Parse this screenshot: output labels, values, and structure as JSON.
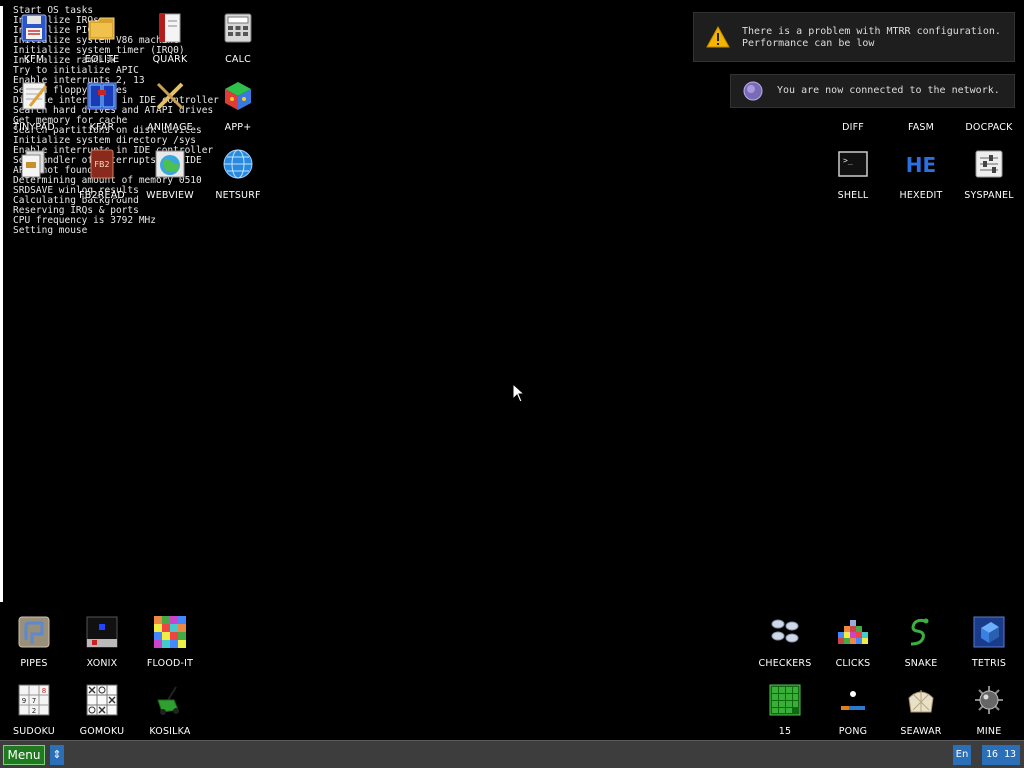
{
  "boot_log": [
    "Start OS tasks",
    "Initialize IRQs",
    "Initialize PIC",
    "Initialize system V86 machine",
    "Initialize system timer (IRQ0)",
    "Initialize ramdisk",
    "Try to initialize APIC",
    "Enable interrupts 2, 13",
    "Search floppy drives",
    "Disable interrupts in IDE controller",
    "Search hard drives and ATAPI drives",
    "Get memory for cache",
    "Search partitions on disk devices",
    "Initialize system directory /sys",
    "Enable interrupts in IDE controller",
    "Set handler of interrupts for IDE",
    "APIC not found",
    "Determining amount of memory 0510",
    "SRDSAVE winlog_results",
    "Calculating background",
    "Reserving IRQs & ports",
    "CPU frequency is 3792 MHz",
    "Setting mouse"
  ],
  "icons_left": [
    {
      "name": "kfm",
      "label": "KFM"
    },
    {
      "name": "eolite",
      "label": "EOLITE"
    },
    {
      "name": "quark",
      "label": "QUARK"
    },
    {
      "name": "calc",
      "label": "CALC"
    },
    {
      "name": "tinypad",
      "label": "TINYPAD"
    },
    {
      "name": "kfar",
      "label": "KFAR"
    },
    {
      "name": "animage",
      "label": "ANIMAGE"
    },
    {
      "name": "app-plus",
      "label": "APP+"
    },
    {
      "name": "fb2read",
      "label": "FB2READ"
    },
    {
      "name": "webview",
      "label": "WEBVIEW"
    },
    {
      "name": "netsurf",
      "label": "NETSURF"
    }
  ],
  "icons_right": [
    {
      "name": "diff",
      "label": "DIFF"
    },
    {
      "name": "fasm",
      "label": "FASM"
    },
    {
      "name": "docpack",
      "label": "DOCPACK"
    },
    {
      "name": "shell",
      "label": "SHELL"
    },
    {
      "name": "hexedit",
      "label": "HEXEDIT"
    },
    {
      "name": "syspanel",
      "label": "SYSPANEL"
    }
  ],
  "icons_games_left": [
    {
      "name": "pipes",
      "label": "PIPES"
    },
    {
      "name": "xonix",
      "label": "XONIX"
    },
    {
      "name": "flood-it",
      "label": "FLOOD-IT"
    },
    {
      "name": "sudoku",
      "label": "SUDOKU"
    },
    {
      "name": "gomoku",
      "label": "GOMOKU"
    },
    {
      "name": "kosilka",
      "label": "KOSILKA"
    }
  ],
  "icons_games_right": [
    {
      "name": "checkers",
      "label": "CHECKERS"
    },
    {
      "name": "clicks",
      "label": "CLICKS"
    },
    {
      "name": "snake",
      "label": "SNAKE"
    },
    {
      "name": "tetris",
      "label": "TETRIS"
    },
    {
      "name": "fifteen",
      "label": "15"
    },
    {
      "name": "pong",
      "label": "PONG"
    },
    {
      "name": "seawar",
      "label": "SEAWAR"
    },
    {
      "name": "mine",
      "label": "MINE"
    }
  ],
  "notifications": {
    "mtrr": {
      "line1": "There is a problem with MTRR configuration.",
      "line2": "Performance can be low",
      "icon": "warning-icon"
    },
    "network": {
      "text": "You are now connected to the network.",
      "icon": "network-icon"
    }
  },
  "taskbar": {
    "menu_label": "Menu",
    "switch_label": "⇕",
    "lang": "En",
    "clock": "16 13"
  },
  "colors": {
    "background": "#000000",
    "taskbar": "#3d3d3d",
    "menu_button": "#1f7a1f",
    "tray_accent": "#2a6fb8",
    "notification_bg": "#1e1e1e"
  }
}
